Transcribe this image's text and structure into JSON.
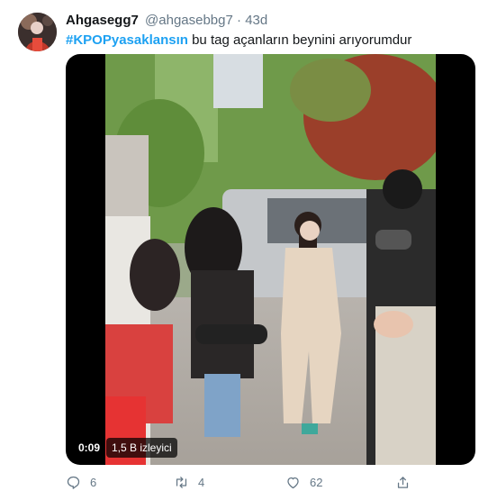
{
  "user": {
    "display_name": "Ahgasegg7",
    "handle": "@ahgasebbg7",
    "separator": "·",
    "time": "43d"
  },
  "tweet": {
    "hashtag": "#KPOPyasaklansın",
    "text": " bu tag açanların beynini arıyorumdur"
  },
  "media": {
    "type": "video",
    "elapsed": "0:09",
    "views": "1,5 B izleyici"
  },
  "actions": {
    "reply_count": "6",
    "retweet_count": "4",
    "like_count": "62"
  },
  "colors": {
    "accent": "#1da1f2",
    "muted": "#657786"
  },
  "icons": [
    "avatar",
    "reply-icon",
    "retweet-icon",
    "like-icon",
    "share-icon"
  ]
}
